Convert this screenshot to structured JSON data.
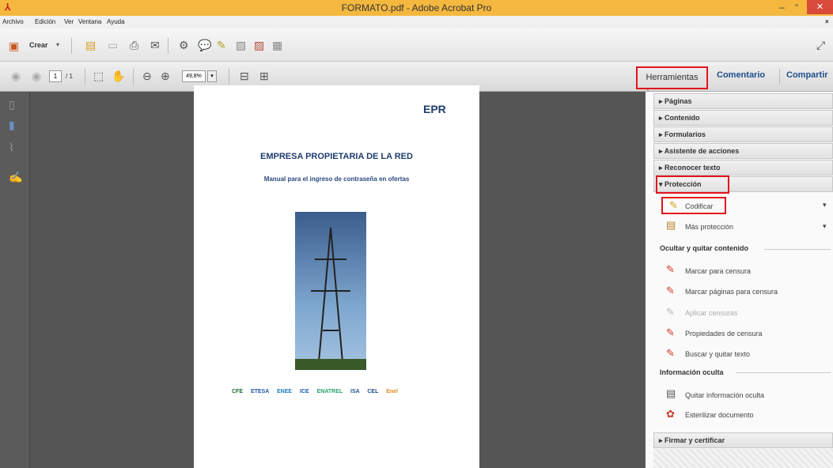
{
  "window": {
    "title": "FORMATO.pdf - Adobe Acrobat Pro"
  },
  "menu": {
    "items": [
      "Archivo",
      "Edición",
      "Ver",
      "Ventana",
      "Ayuda"
    ]
  },
  "toolbar": {
    "create_label": "Crear",
    "page_current": "1",
    "page_total": "/ 1",
    "zoom": "49,8%"
  },
  "tabs": {
    "tools": "Herramientas",
    "comment": "Comentario",
    "share": "Compartir"
  },
  "sections": {
    "paginas": "Páginas",
    "contenido": "Contenido",
    "formularios": "Formularios",
    "asistente": "Asistente de acciones",
    "reconocer": "Reconocer texto",
    "proteccion": "Protección",
    "firmar": "Firmar y certificar"
  },
  "proteccion_items": {
    "codificar": "Codificar",
    "mas": "Más protección"
  },
  "ocultar": {
    "header": "Ocultar y quitar contenido",
    "items": [
      "Marcar para censura",
      "Marcar páginas para censura",
      "Aplicar censuras",
      "Propiedades de censura",
      "Buscar y quitar texto"
    ]
  },
  "info_oculta": {
    "header": "Información oculta",
    "items": [
      "Quitar información oculta",
      "Esterilizar documento"
    ]
  },
  "document": {
    "heading": "EMPRESA PROPIETARIA DE LA RED",
    "subtitle": "Manual para el ingreso de contraseña en ofertas",
    "logos": [
      "CFE",
      "ETESA",
      "ENEE",
      "ICE",
      "ENATREL",
      "ISA",
      "CEL",
      "Enel"
    ],
    "brand": "EPR"
  },
  "colors": {
    "title_bar": "#f4b83f",
    "highlight": "#e3141c",
    "accent_blue": "#1f4e8c"
  }
}
